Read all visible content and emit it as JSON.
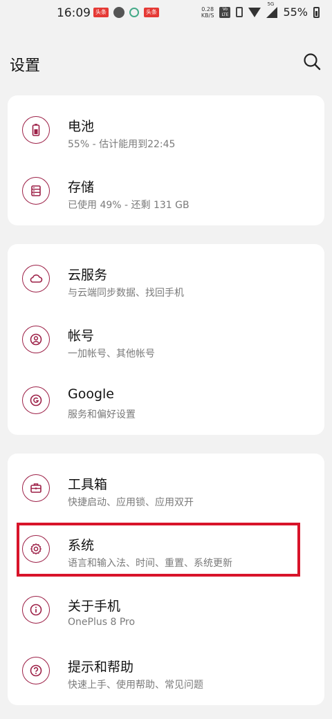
{
  "status_bar": {
    "time": "16:09",
    "notif_badge_1": "头条",
    "notif_badge_2": "头条",
    "net_speed_value": "0.28",
    "net_speed_unit": "KB/S",
    "volte": "Vo LTE",
    "network": "5G",
    "battery": "55%"
  },
  "header": {
    "title": "设置"
  },
  "groups": [
    {
      "items": [
        {
          "title": "电池",
          "subtitle": "55% - 估计能用到22:45",
          "icon": "battery-icon"
        },
        {
          "title": "存储",
          "subtitle": "已使用 49% - 还剩 131 GB",
          "icon": "storage-icon"
        }
      ]
    },
    {
      "items": [
        {
          "title": "云服务",
          "subtitle": "与云端同步数据、找回手机",
          "icon": "cloud-icon"
        },
        {
          "title": "帐号",
          "subtitle": "一加帐号、其他帐号",
          "icon": "account-icon"
        },
        {
          "title": "Google",
          "subtitle": "服务和偏好设置",
          "icon": "google-icon"
        }
      ]
    },
    {
      "items": [
        {
          "title": "工具箱",
          "subtitle": "快捷启动、应用锁、应用双开",
          "icon": "toolbox-icon"
        },
        {
          "title": "系统",
          "subtitle": "语言和输入法、时间、重置、系统更新",
          "icon": "gear-icon"
        },
        {
          "title": "关于手机",
          "subtitle": "OnePlus 8 Pro",
          "icon": "info-icon"
        },
        {
          "title": "提示和帮助",
          "subtitle": "快速上手、使用帮助、常见问题",
          "icon": "help-icon"
        }
      ]
    }
  ],
  "colors": {
    "accent": "#9c1f46",
    "highlight": "#d8142a",
    "background": "#f2f2f2"
  }
}
